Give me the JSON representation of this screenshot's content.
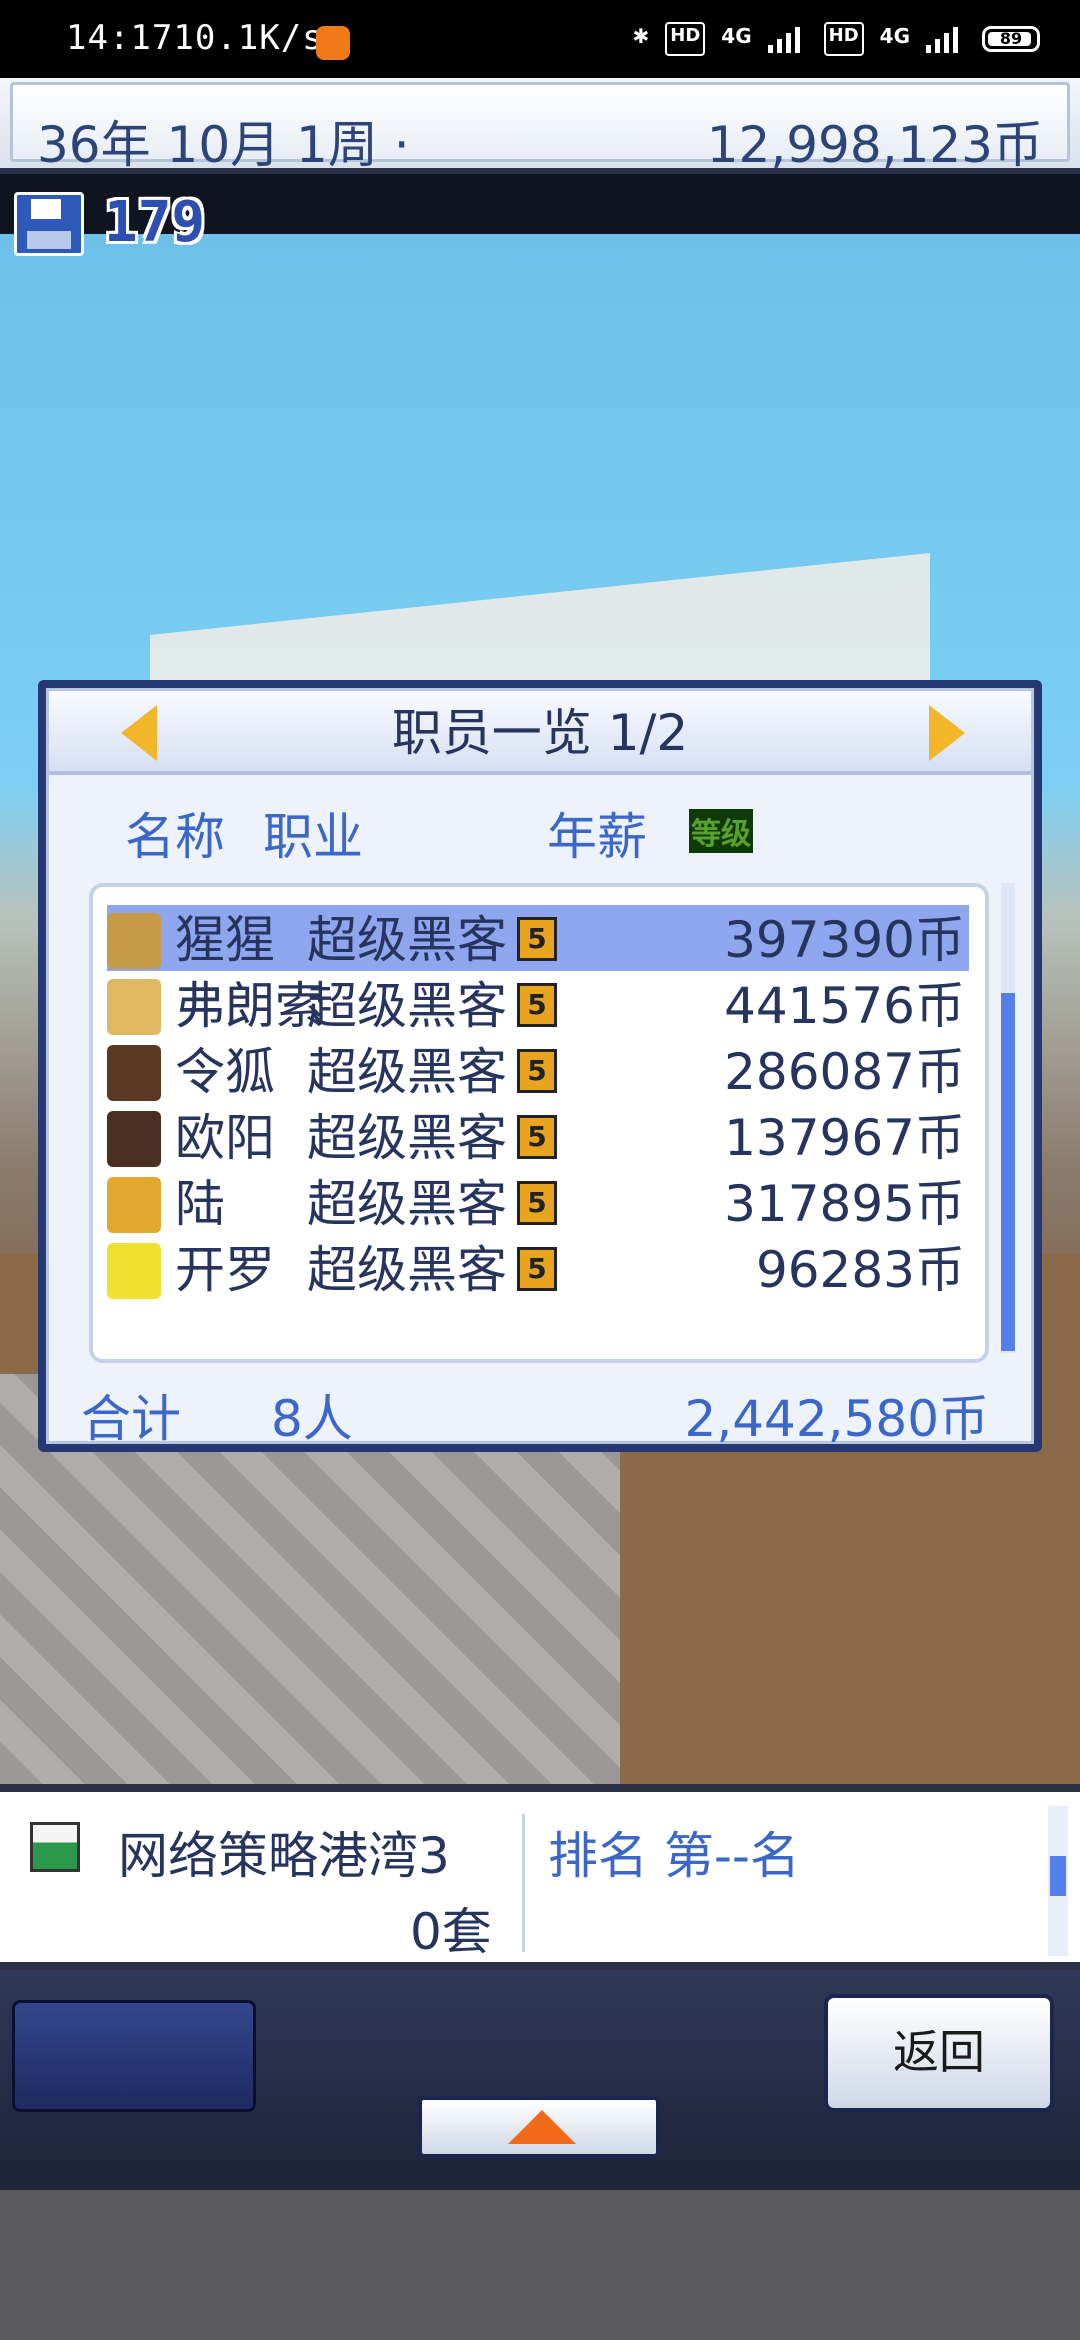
{
  "status_bar": {
    "time": "14:17",
    "net_speed": "10.1K/s",
    "battery": "89",
    "signal_a": "4G",
    "signal_b": "4G",
    "hd_a": "HD",
    "hd_b": "HD"
  },
  "header": {
    "date": "36年 10月 1周 ·",
    "money": "12,998,123币"
  },
  "save_count": "179",
  "staff_panel": {
    "title": "职员一览 1/2",
    "columns": {
      "name": "名称",
      "job": "职业",
      "level": "等级",
      "salary": "年薪"
    },
    "rows": [
      {
        "name": "猩猩",
        "job": "超级黑客",
        "level": "5",
        "salary": "397390币",
        "selected": true,
        "avatar_color": "#c79a4a"
      },
      {
        "name": "弗朗索",
        "job": "超级黑客",
        "level": "5",
        "salary": "441576币",
        "selected": false,
        "avatar_color": "#e0b860"
      },
      {
        "name": "令狐",
        "job": "超级黑客",
        "level": "5",
        "salary": "286087币",
        "selected": false,
        "avatar_color": "#5b3a24"
      },
      {
        "name": "欧阳",
        "job": "超级黑客",
        "level": "5",
        "salary": "137967币",
        "selected": false,
        "avatar_color": "#4a3020"
      },
      {
        "name": "陆",
        "job": "超级黑客",
        "level": "5",
        "salary": "317895币",
        "selected": false,
        "avatar_color": "#e3a830"
      },
      {
        "name": "开罗",
        "job": "超级黑客",
        "level": "5",
        "salary": "96283币",
        "selected": false,
        "avatar_color": "#f0e030"
      }
    ],
    "totals": {
      "label": "合计",
      "people": "8人",
      "sum": "2,442,580币"
    }
  },
  "game_info": {
    "title": "网络策略港湾3",
    "sets": "0套",
    "rank": "排名 第--名"
  },
  "footer": {
    "back_label": "返回"
  }
}
